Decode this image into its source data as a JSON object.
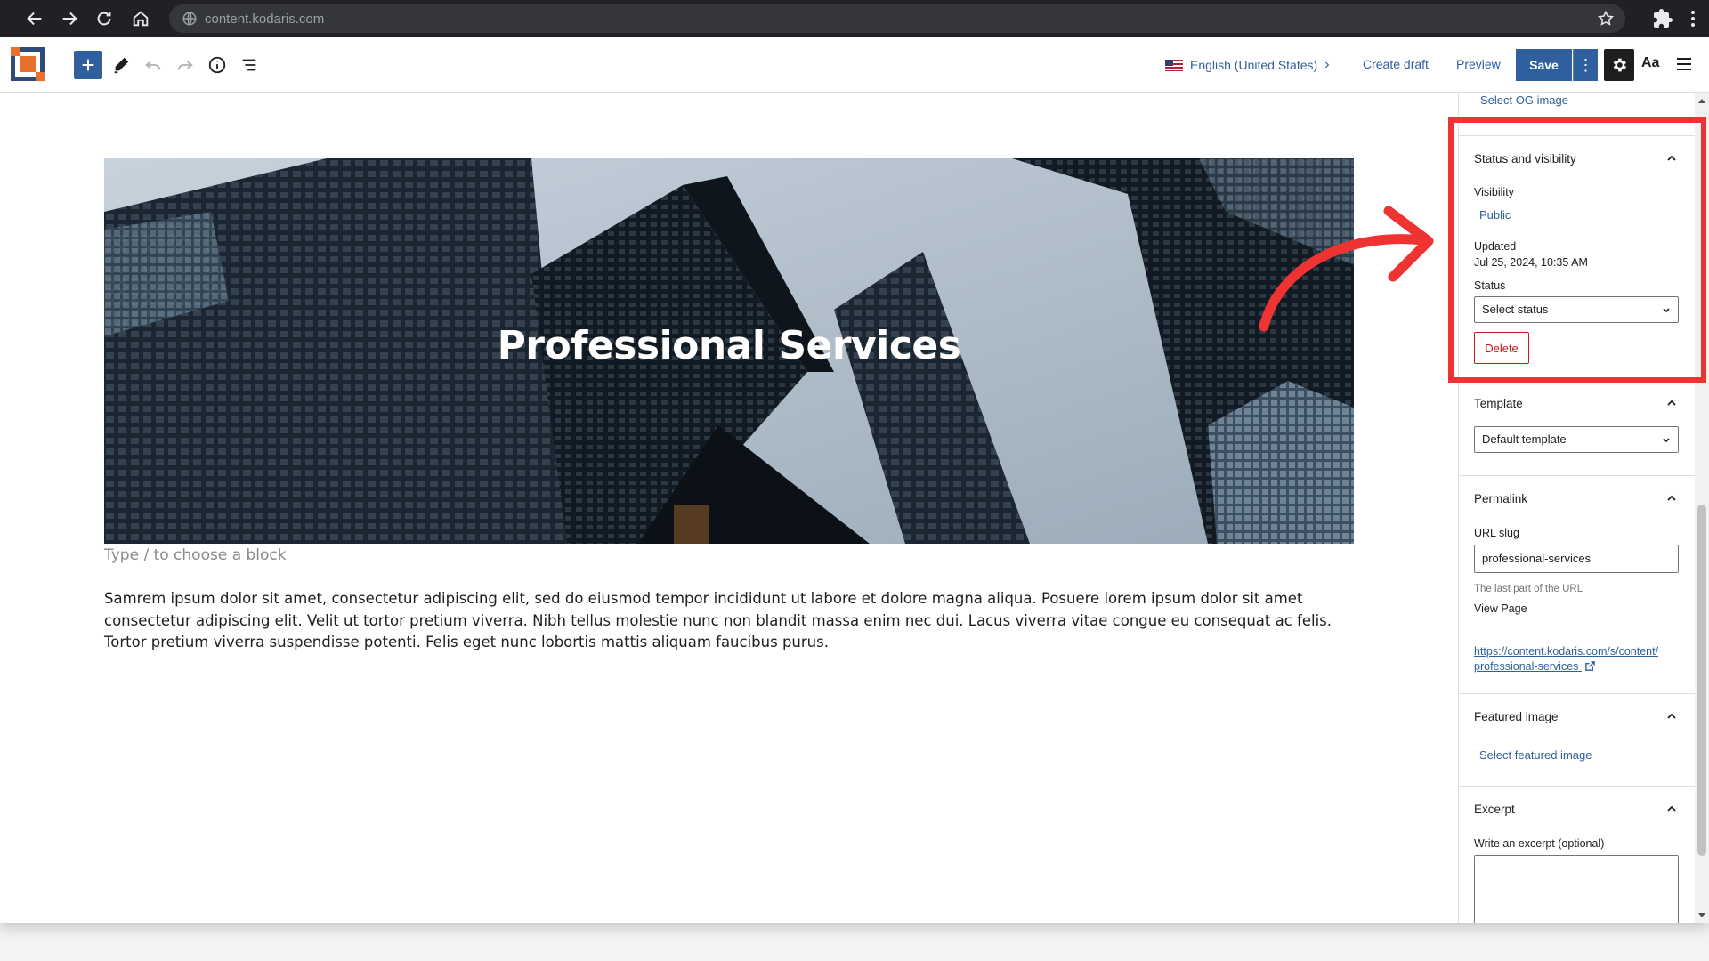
{
  "browser": {
    "url": "content.kodaris.com"
  },
  "toolbar": {
    "language": "English (United States)",
    "create_draft": "Create draft",
    "preview": "Preview",
    "save": "Save",
    "aa": "Aa"
  },
  "canvas": {
    "cover_title": "Professional Services",
    "block_placeholder": "Type / to choose a block",
    "paragraph": "Samrem ipsum dolor sit amet, consectetur adipiscing elit, sed do eiusmod tempor incididunt ut labore et dolore magna aliqua. Posuere lorem ipsum dolor sit amet consectetur adipiscing elit. Velit ut tortor pretium viverra. Nibh tellus molestie nunc non blandit massa enim nec dui. Lacus viverra vitae congue eu consequat ac felis. Tortor pretium viverra suspendisse potenti. Felis eget nunc lobortis mattis aliquam faucibus purus."
  },
  "sidebar": {
    "og_image_link": "Select OG image",
    "status_visibility": {
      "title": "Status and visibility",
      "visibility_label": "Visibility",
      "visibility_value": "Public",
      "updated_label": "Updated",
      "updated_value": "Jul 25, 2024, 10:35 AM",
      "status_label": "Status",
      "status_value": "Select status",
      "delete": "Delete"
    },
    "template": {
      "title": "Template",
      "value": "Default template"
    },
    "permalink": {
      "title": "Permalink",
      "slug_label": "URL slug",
      "slug_value": "professional-services",
      "help": "The last part of the URL",
      "view_page": "View Page",
      "url_line1": "https://content.kodaris.com/s/content/",
      "url_line2": "professional-services"
    },
    "featured_image": {
      "title": "Featured image",
      "link": "Select featured image"
    },
    "excerpt": {
      "title": "Excerpt",
      "label": "Write an excerpt (optional)"
    }
  },
  "colors": {
    "accent": "#2f5f9e",
    "danger": "#cc1818",
    "annotation": "#ef3333"
  }
}
